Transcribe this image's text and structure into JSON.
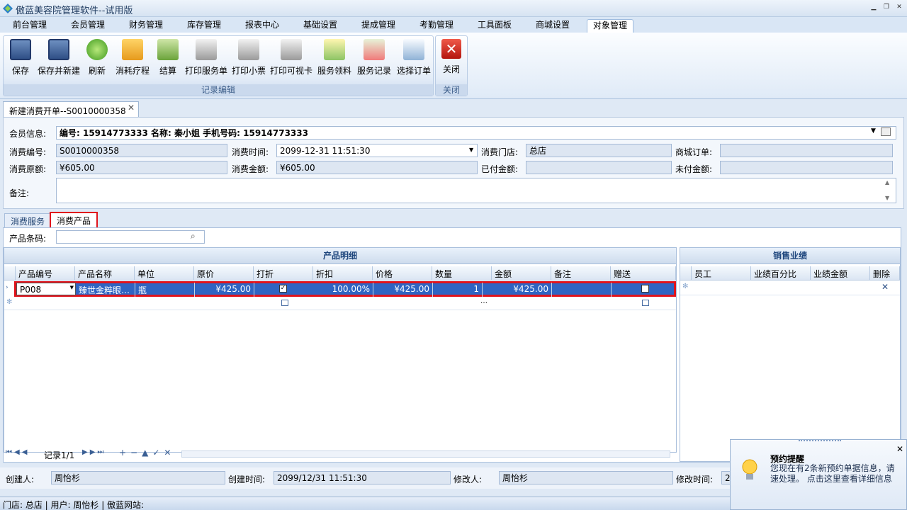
{
  "window": {
    "title": "傲蓝美容院管理软件--试用版"
  },
  "menu": [
    "前台管理",
    "会员管理",
    "财务管理",
    "库存管理",
    "报表中心",
    "基础设置",
    "提成管理",
    "考勤管理",
    "工具面板",
    "商城设置",
    "对象管理"
  ],
  "ribbon": {
    "group1_label": "记录编辑",
    "group2_label": "关闭",
    "buttons": [
      "保存",
      "保存并新建",
      "刷新",
      "消耗疗程",
      "结算",
      "打印服务单",
      "打印小票",
      "打印可视卡",
      "服务领料",
      "服务记录",
      "选择订单"
    ],
    "close_label": "关闭"
  },
  "doctab": {
    "label": "新建消费开单--S0010000358"
  },
  "form": {
    "member_label": "会员信息:",
    "member_value": "编号: 15914773333    名称: 秦小姐    手机号码: 15914773333",
    "code_label": "消费编号:",
    "code_value": "S0010000358",
    "time_label": "消费时间:",
    "time_value": "2099-12-31 11:51:30",
    "store_label": "消费门店:",
    "store_value": "总店",
    "mall_label": "商城订单:",
    "mall_value": "",
    "orig_label": "消费原额:",
    "orig_value": "¥605.00",
    "amount_label": "消费金额:",
    "amount_value": "¥605.00",
    "paid_label": "已付金额:",
    "paid_value": "",
    "unpaid_label": "未付金额:",
    "unpaid_value": "",
    "note_label": "备注:",
    "note_value": ""
  },
  "subtabs": [
    "消费服务",
    "消费产品"
  ],
  "barcode": {
    "label": "产品条码:",
    "value": ""
  },
  "products": {
    "title": "产品明细",
    "columns": [
      "产品编号",
      "产品名称",
      "单位",
      "原价",
      "打折",
      "折扣",
      "价格",
      "数量",
      "金额",
      "备注",
      "赠送"
    ],
    "rows": [
      {
        "code": "P008",
        "name": "臻世金粹眼…",
        "unit": "瓶",
        "orig": "¥425.00",
        "discount_pct": "100.00%",
        "price": "¥425.00",
        "qty": "1",
        "amount": "¥425.00",
        "note": ""
      }
    ]
  },
  "sales": {
    "title": "销售业绩",
    "columns": [
      "员工",
      "业绩百分比",
      "业绩金额",
      "删除"
    ]
  },
  "nav": {
    "record": "记录1/1"
  },
  "footer": {
    "creator_label": "创建人:",
    "creator": "周怡杉",
    "ctime_label": "创建时间:",
    "ctime": "2099/12/31 11:51:30",
    "modifier_label": "修改人:",
    "modifier": "周怡杉",
    "mtime_label": "修改时间:",
    "mtime": "2"
  },
  "status": {
    "text": "门店: 总店 | 用户: 周怡杉 | 傲蓝网站:"
  },
  "popup": {
    "title": "预约提醒",
    "body": "您现在有2条新预约单据信息，请速处理。 点击这里查看详细信息"
  }
}
